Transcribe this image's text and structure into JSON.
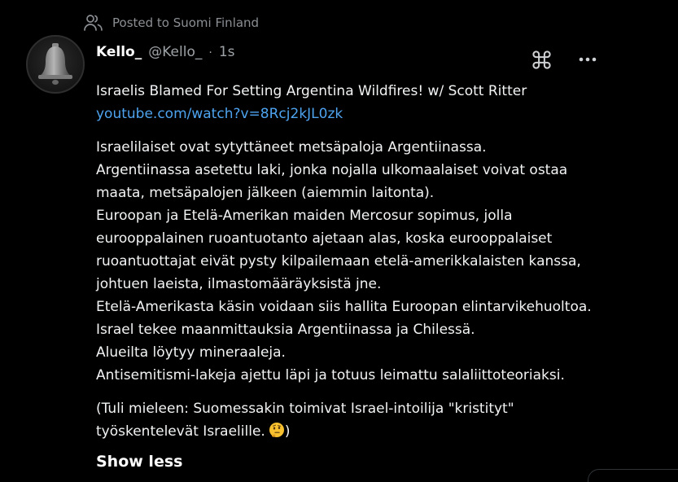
{
  "posted_to": {
    "icon": "people-icon",
    "label": "Posted to Suomi Finland"
  },
  "author": {
    "avatar_icon": "bell-avatar",
    "display_name": "Kello_",
    "handle": "@Kello_",
    "separator": "·",
    "time": "1s"
  },
  "actions": {
    "command_icon": "command-icon",
    "more_icon": "more-horizontal-icon"
  },
  "post": {
    "title_line": "Israelis Blamed For Setting Argentina Wildfires! w/ Scott Ritter",
    "link": "youtube.com/watch?v=8Rcj2kJL0zk",
    "lines": [
      "Israelilaiset ovat sytyttäneet metsäpaloja Argentiinassa.",
      "Argentiinassa asetettu laki, jonka nojalla ulkomaalaiset voivat ostaa",
      "maata, metsäpalojen jälkeen (aiemmin laitonta).",
      "Euroopan ja Etelä-Amerikan maiden Mercosur sopimus, jolla",
      "eurooppalainen ruoantuotanto ajetaan alas, koska eurooppalaiset",
      "ruoantuottajat eivät pysty kilpailemaan etelä-amerikkalaisten kanssa,",
      "johtuen laeista, ilmastomääräyksistä jne.",
      "Etelä-Amerikasta käsin voidaan siis hallita Euroopan elintarvikehuoltoa.",
      "Israel tekee maanmittauksia Argentiinassa ja Chilessä.",
      "Alueilta löytyy mineraaleja.",
      "Antisemitismi-lakeja ajettu läpi ja totuus leimattu salaliittoteoriaksi."
    ],
    "closing_line_1": "(Tuli mieleen: Suomessakin toimivat Israel-intoilija \"kristityt\"",
    "closing_line_2_text": "työskentelevät Israelille.",
    "closing_emoji": "thinking-face-emoji",
    "closing_line_2_end": ")"
  },
  "show_less_label": "Show less",
  "colors": {
    "background": "#000000",
    "text": "#f2f3f4",
    "muted": "#9ea3a7",
    "link": "#4ea3ef"
  }
}
